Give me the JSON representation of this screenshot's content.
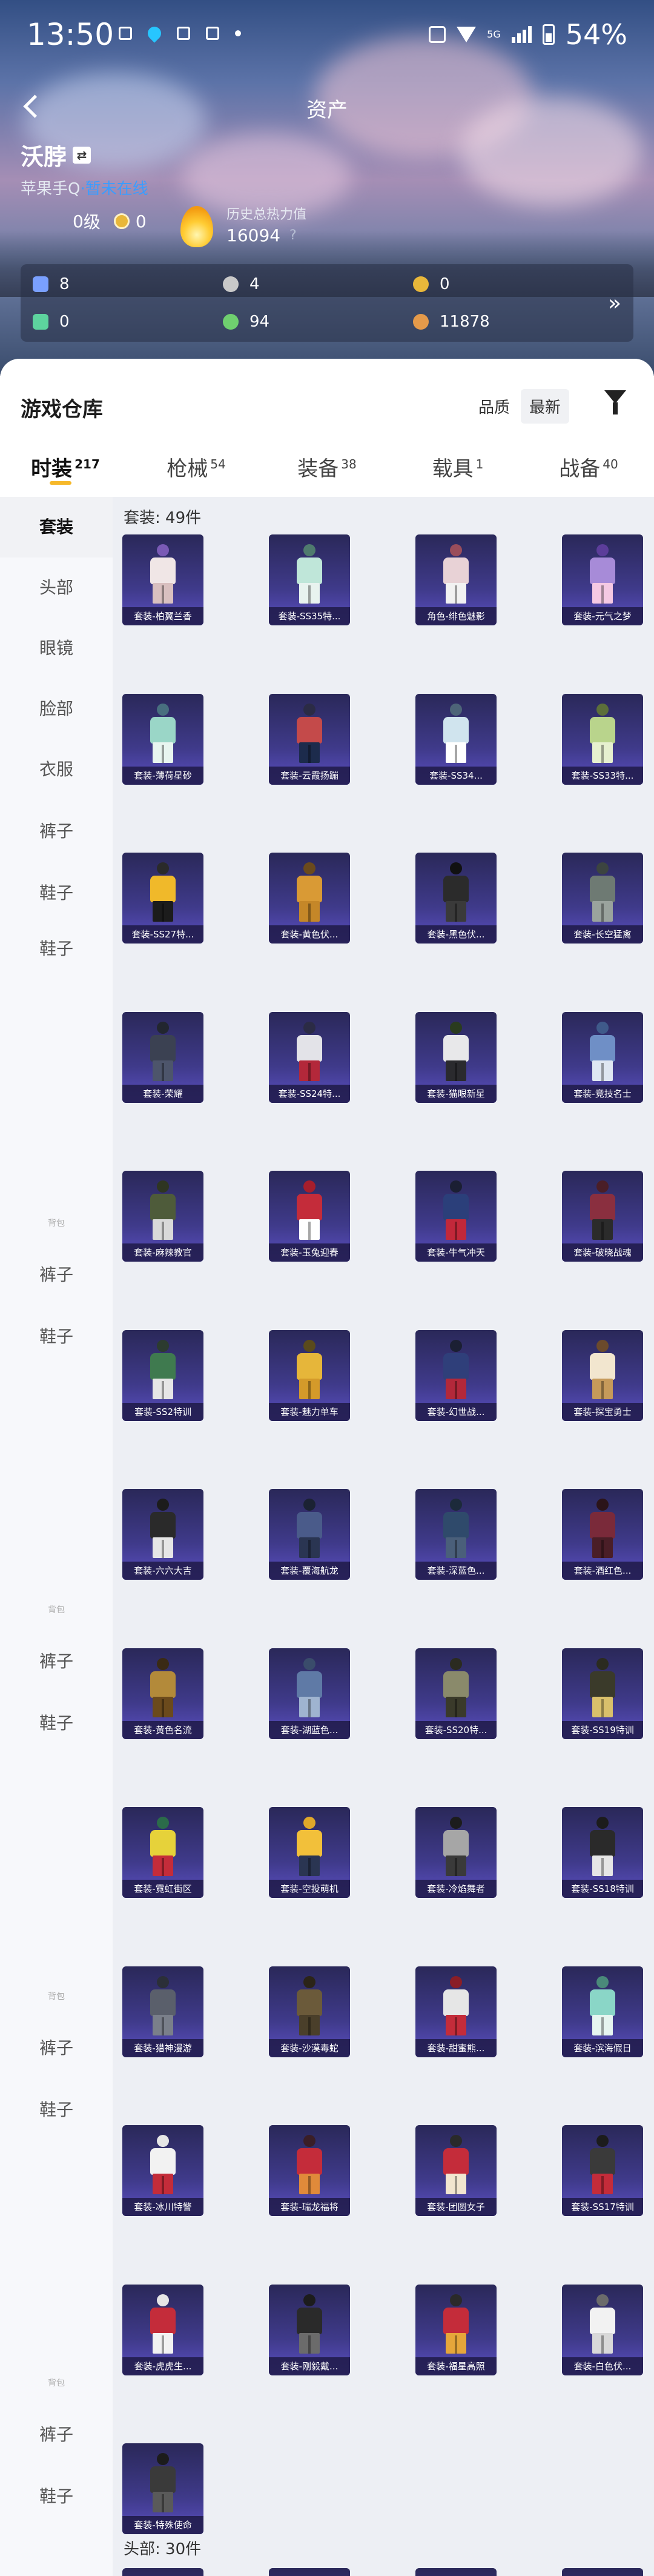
{
  "status_bar": {
    "time": "13:50",
    "battery": "54%",
    "network": "5G"
  },
  "nav": {
    "title": "资产"
  },
  "profile": {
    "name": "沃脖",
    "swap_label": "⇄",
    "platform": "苹果手Q",
    "status": "暂未在线"
  },
  "stats": {
    "level_value": "0",
    "level_unit": "级",
    "coin_value": "0",
    "heat_label": "历史总热力值",
    "heat_value": "16094",
    "heat_help": "?"
  },
  "assets": [
    {
      "value": "8",
      "icon": "card-icon",
      "color": "#7aa0ff"
    },
    {
      "value": "4",
      "icon": "gear-icon",
      "color": "#c9c9c9"
    },
    {
      "value": "0",
      "icon": "coin-icon",
      "color": "#e8b73a"
    },
    {
      "value": "0",
      "icon": "bag-icon",
      "color": "#5dd39e"
    },
    {
      "value": "94",
      "icon": "ball-icon",
      "color": "#6fcf6f"
    },
    {
      "value": "11878",
      "icon": "ticket-icon",
      "color": "#e59a4a"
    }
  ],
  "assets_more": "»",
  "warehouse": {
    "title": "游戏仓库",
    "sort": [
      "品质",
      "最新"
    ],
    "tabs": [
      {
        "label": "时装",
        "count": "217"
      },
      {
        "label": "枪械",
        "count": "54"
      },
      {
        "label": "装备",
        "count": "38"
      },
      {
        "label": "载具",
        "count": "1"
      },
      {
        "label": "战备",
        "count": "40"
      }
    ],
    "sidebar": [
      "套装",
      "头部",
      "眼镜",
      "脸部",
      "衣服",
      "裤子",
      "鞋子",
      "鞋子",
      "裤子",
      "鞋子",
      "裤子",
      "鞋子",
      "裤子",
      "鞋子",
      "裤子",
      "鞋子"
    ],
    "sidebar_faint": "背包",
    "section_suits": "套装: 49件",
    "section_head": "头部: 30件",
    "items": [
      "套装-柏翼兰香",
      "套装-SS35特...",
      "角色-绯色魅影",
      "套装-元气之梦",
      "套装-薄荷星砂",
      "套装-云霞扬蹦",
      "套装-SS34...",
      "套装-SS33特...",
      "套装-SS27特...",
      "套装-黄色伏...",
      "套装-黑色伏...",
      "套装-长空猛禽",
      "套装-荣耀",
      "套装-SS24特...",
      "套装-猫眼新星",
      "套装-竞技名士",
      "套装-麻辣教官",
      "套装-玉兔迎春",
      "套装-牛气冲天",
      "套装-破晓战魂",
      "套装-SS2特训",
      "套装-魅力单车",
      "套装-幻世战...",
      "套装-探宝勇士",
      "套装-六六大吉",
      "套装-覆海航龙",
      "套装-深蓝色...",
      "套装-酒红色...",
      "套装-黄色名流",
      "套装-湖蓝色...",
      "套装-SS20特...",
      "套装-SS19特训",
      "套装-霓虹街区",
      "套装-空投萌机",
      "套装-冷焰舞者",
      "套装-SS18特训",
      "套装-猎神漫游",
      "套装-沙漠毒蛇",
      "套装-甜蜜熊...",
      "套装-滨海假日",
      "套装-冰川特警",
      "套装-瑞龙福将",
      "套装-团圆女子",
      "套装-SS17特训",
      "套装-虎虎生...",
      "套装-刚毅戴...",
      "套装-福星高照",
      "套装-白色伏...",
      "套装-特殊使命"
    ],
    "head_items": [
      "",
      "",
      "",
      ""
    ]
  }
}
